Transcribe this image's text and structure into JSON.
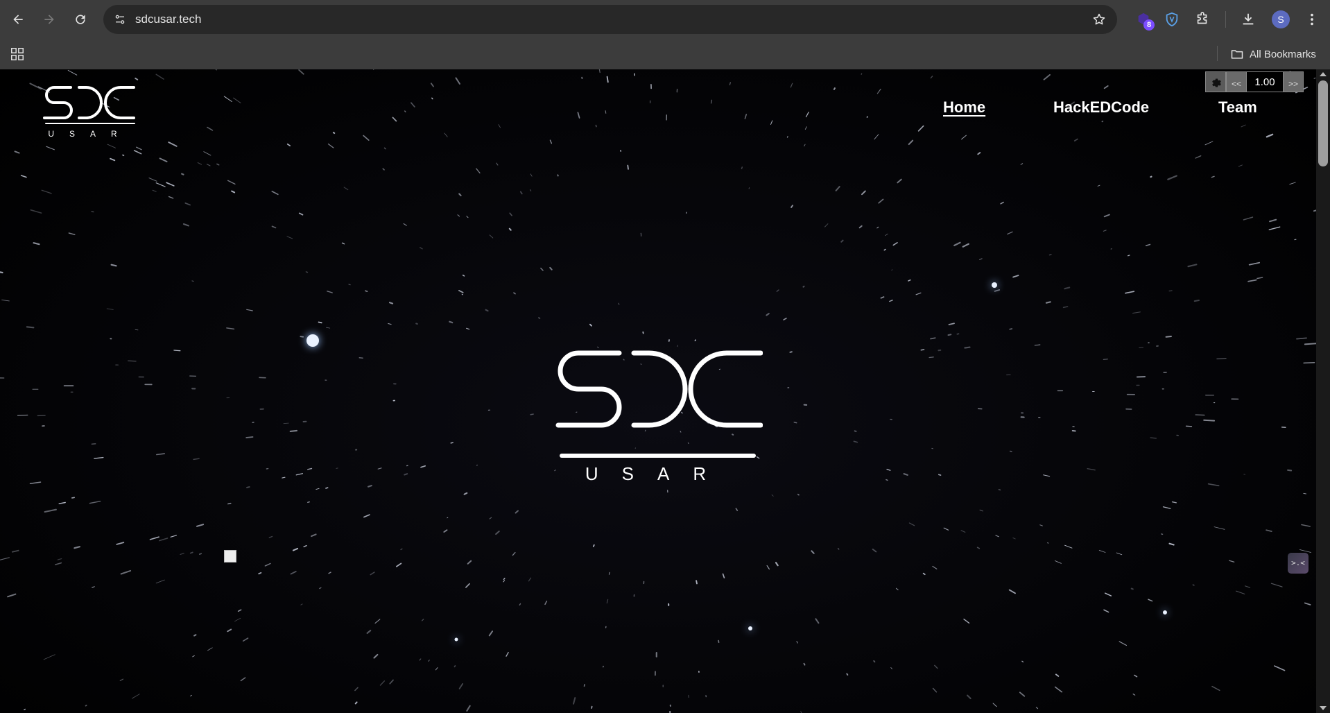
{
  "browser": {
    "url": "sdcusar.tech",
    "extension_badge": "8",
    "profile_initial": "S",
    "bookmarks_label": "All Bookmarks"
  },
  "speed_control": {
    "decrease_label": "<<",
    "value": "1.00",
    "increase_label": ">>"
  },
  "nav": {
    "items": [
      {
        "label": "Home",
        "active": true
      },
      {
        "label": "HackEDCode",
        "active": false
      },
      {
        "label": "Team",
        "active": false
      }
    ]
  },
  "logo": {
    "main": "SDC",
    "sub": "USAR"
  },
  "side_widget": {
    "label": ">.<"
  },
  "colors": {
    "chrome_bg": "#3c3c3c",
    "omnibox_bg": "#282828",
    "page_bg": "#000000",
    "text_white": "#ffffff"
  }
}
